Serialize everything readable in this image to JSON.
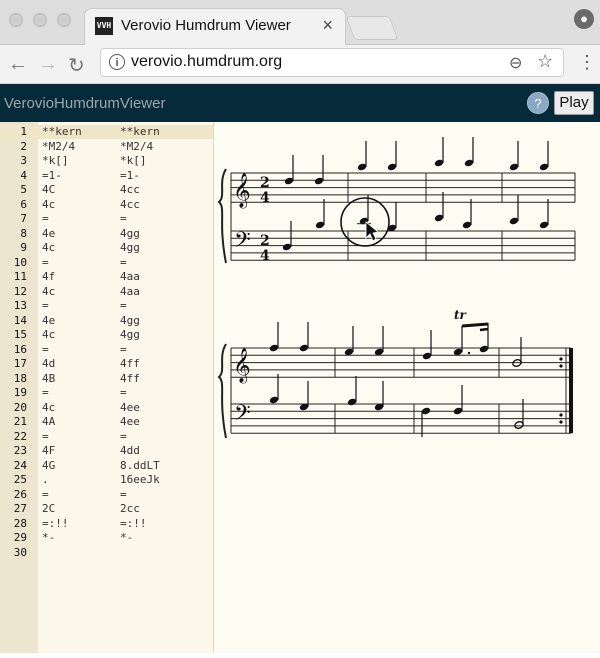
{
  "browser": {
    "tab_title": "Verovio Humdrum Viewer",
    "tab_favicon": "VVH",
    "url": "verovio.humdrum.org",
    "icons": [
      "back-icon",
      "forward-icon",
      "reload-icon",
      "info-icon",
      "zoom-icon",
      "star-icon",
      "menu-icon",
      "profile-icon"
    ]
  },
  "app": {
    "title": "VerovioHumdrumViewer",
    "help_label": "?",
    "play_label": "Play"
  },
  "editor": {
    "lines": [
      {
        "n": "1",
        "c1": "**kern",
        "c2": "**kern"
      },
      {
        "n": "2",
        "c1": "*M2/4",
        "c2": "*M2/4"
      },
      {
        "n": "3",
        "c1": "*k[]",
        "c2": "*k[]"
      },
      {
        "n": "4",
        "c1": "=1-",
        "c2": "=1-"
      },
      {
        "n": "5",
        "c1": "4C",
        "c2": "4cc"
      },
      {
        "n": "6",
        "c1": "4c",
        "c2": "4cc"
      },
      {
        "n": "7",
        "c1": "=",
        "c2": "="
      },
      {
        "n": "8",
        "c1": "4e",
        "c2": "4gg"
      },
      {
        "n": "9",
        "c1": "4c",
        "c2": "4gg"
      },
      {
        "n": "10",
        "c1": "=",
        "c2": "="
      },
      {
        "n": "11",
        "c1": "4f",
        "c2": "4aa"
      },
      {
        "n": "12",
        "c1": "4c",
        "c2": "4aa"
      },
      {
        "n": "13",
        "c1": "=",
        "c2": "="
      },
      {
        "n": "14",
        "c1": "4e",
        "c2": "4gg"
      },
      {
        "n": "15",
        "c1": "4c",
        "c2": "4gg"
      },
      {
        "n": "16",
        "c1": "=",
        "c2": "="
      },
      {
        "n": "17",
        "c1": "4d",
        "c2": "4ff"
      },
      {
        "n": "18",
        "c1": "4B",
        "c2": "4ff"
      },
      {
        "n": "19",
        "c1": "=",
        "c2": "="
      },
      {
        "n": "20",
        "c1": "4c",
        "c2": "4ee"
      },
      {
        "n": "21",
        "c1": "4A",
        "c2": "4ee"
      },
      {
        "n": "22",
        "c1": "=",
        "c2": "="
      },
      {
        "n": "23",
        "c1": "4F",
        "c2": "4dd"
      },
      {
        "n": "24",
        "c1": "4G",
        "c2": "8.ddLT"
      },
      {
        "n": "25",
        "c1": ".",
        "c2": "16eeJk"
      },
      {
        "n": "26",
        "c1": "=",
        "c2": "="
      },
      {
        "n": "27",
        "c1": "2C",
        "c2": "2cc"
      },
      {
        "n": "28",
        "c1": "=:!!",
        "c2": "=:!!"
      },
      {
        "n": "29",
        "c1": "*-",
        "c2": "*-"
      },
      {
        "n": "30",
        "c1": "",
        "c2": ""
      }
    ],
    "active_line": "1"
  },
  "notation": {
    "time_signature": [
      "2",
      "4"
    ],
    "trill_mark": "tr"
  }
}
